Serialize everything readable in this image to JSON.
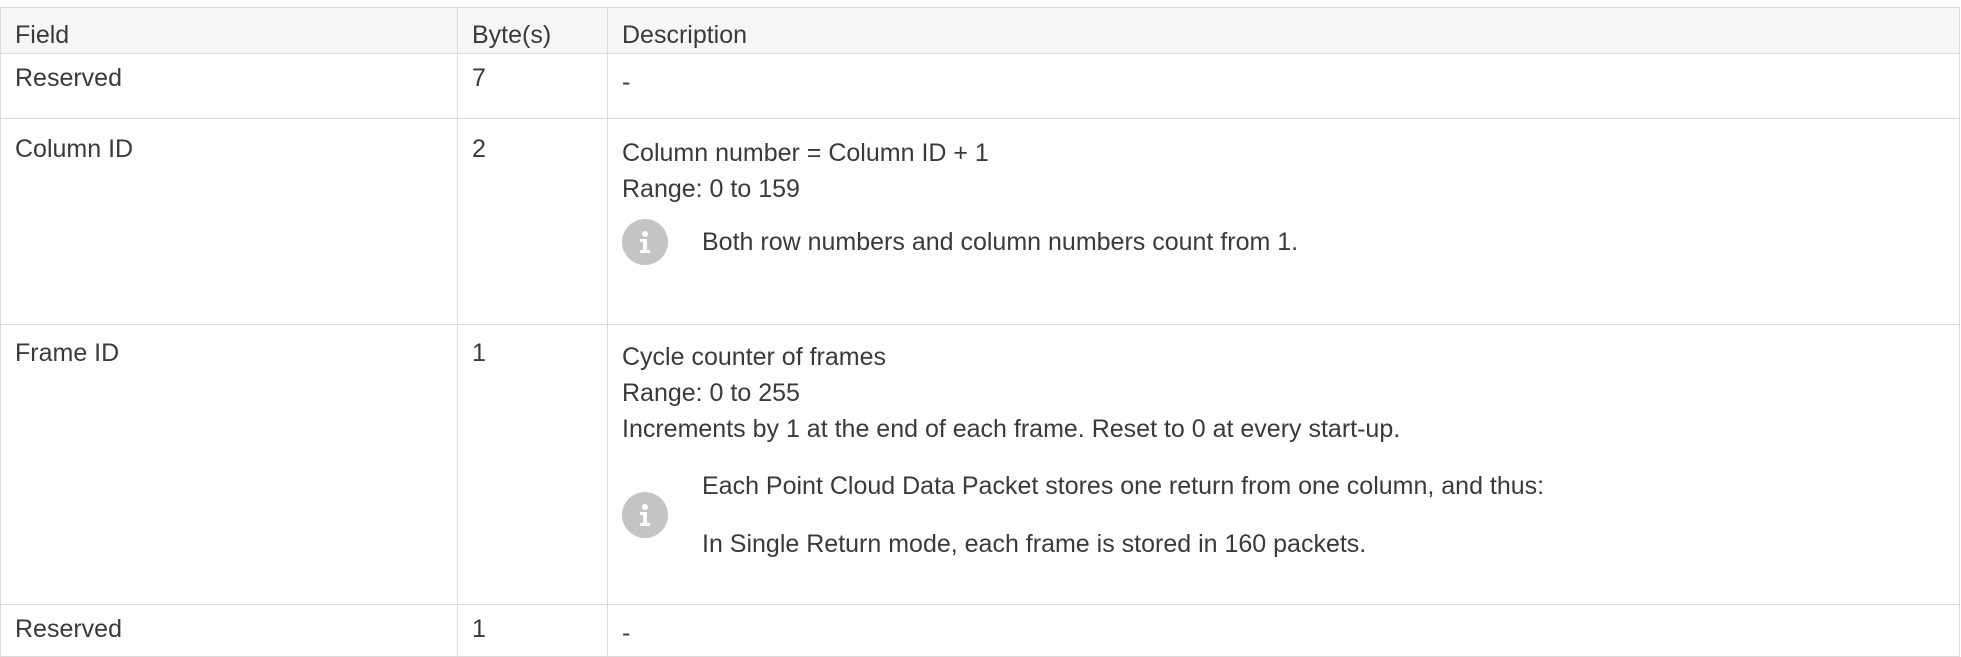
{
  "table": {
    "headers": {
      "field": "Field",
      "bytes": "Byte(s)",
      "description": "Description"
    },
    "rows": [
      {
        "field": "Reserved",
        "bytes": "7",
        "desc": [
          "-"
        ]
      },
      {
        "field": "Column ID",
        "bytes": "2",
        "desc": [
          "Column number = Column ID + 1",
          "Range: 0 to 159"
        ],
        "note": [
          "Both row numbers and column numbers count from 1."
        ]
      },
      {
        "field": "Frame ID",
        "bytes": "1",
        "desc": [
          "Cycle counter of frames",
          "Range: 0 to 255",
          "Increments by 1 at the end of each frame. Reset to 0 at every start-up."
        ],
        "note": [
          "Each Point Cloud Data Packet stores one return from one column, and thus:",
          "In Single Return mode, each frame is stored in 160 packets."
        ]
      },
      {
        "field": "Reserved",
        "bytes": "1",
        "desc": [
          "-"
        ]
      }
    ]
  },
  "icons": {
    "note_icon": "info-icon",
    "note_icon_color": "#c4c4c4"
  }
}
